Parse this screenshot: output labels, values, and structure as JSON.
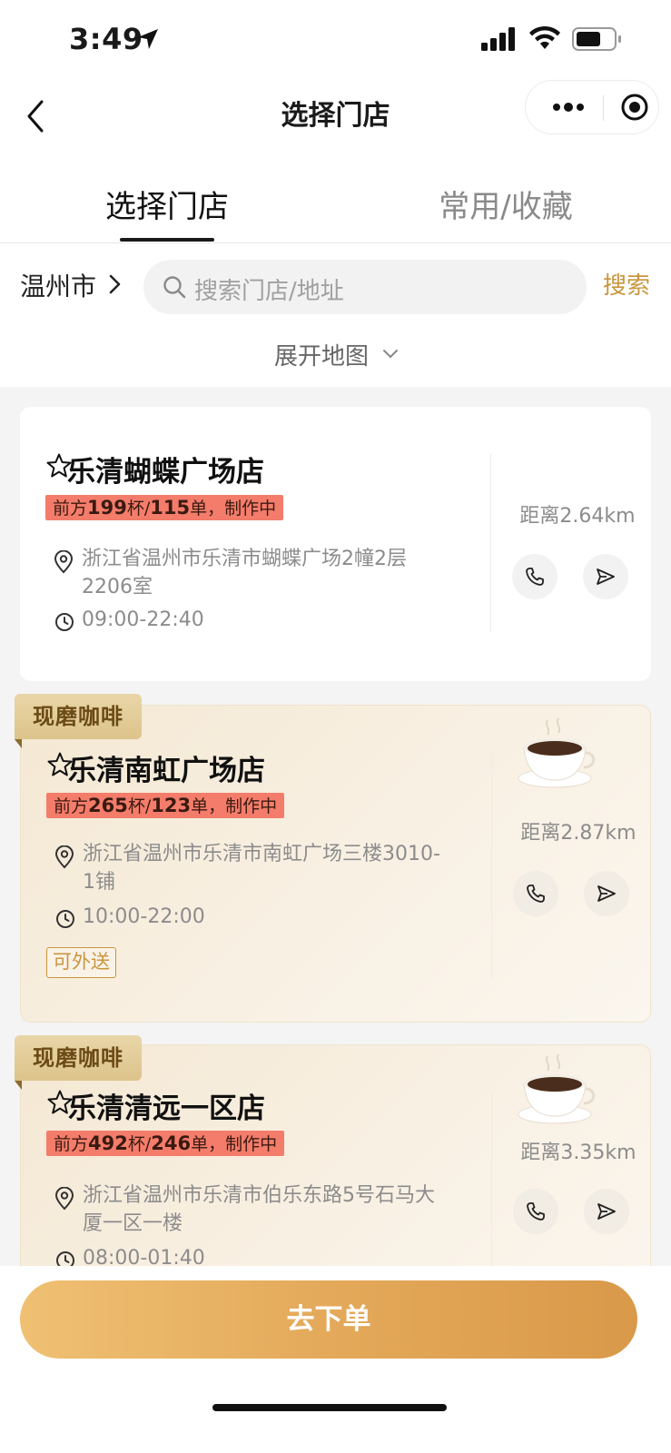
{
  "status_bar": {
    "time": "3:49"
  },
  "nav": {
    "title": "选择门店"
  },
  "tabs": [
    {
      "label": "选择门店",
      "active": true
    },
    {
      "label": "常用/收藏",
      "active": false
    }
  ],
  "search": {
    "city": "温州市",
    "placeholder": "搜索门店/地址",
    "button": "搜索"
  },
  "expand_map": "展开地图",
  "stores": [
    {
      "name": "乐清蝴蝶广场店",
      "queue_prefix": "前方",
      "cups": "199",
      "cups_unit": "杯/",
      "orders": "115",
      "queue_suffix": "单，制作中",
      "address": "浙江省温州市乐清市蝴蝶广场2幢2层2206室",
      "hours": "09:00-22:40",
      "distance": "距离2.64km"
    },
    {
      "name": "乐清南虹广场店",
      "ribbon": "现磨咖啡",
      "queue_prefix": "前方",
      "cups": "265",
      "cups_unit": "杯/",
      "orders": "123",
      "queue_suffix": "单，制作中",
      "address": "浙江省温州市乐清市南虹广场三楼3010-1铺",
      "hours": "10:00-22:00",
      "distance": "距离2.87km",
      "delivery_tag": "可外送"
    },
    {
      "name": "乐清清远一区店",
      "ribbon": "现磨咖啡",
      "queue_prefix": "前方",
      "cups": "492",
      "cups_unit": "杯/",
      "orders": "246",
      "queue_suffix": "单，制作中",
      "address": "浙江省温州市乐清市伯乐东路5号石马大厦一区一楼",
      "hours": "08:00-01:40",
      "distance": "距离3.35km"
    }
  ],
  "order_button": "去下单",
  "colors": {
    "accent": "#c9963f",
    "badge": "#f47c6b",
    "order_button_start": "#efc073",
    "order_button_end": "#d9994a"
  }
}
